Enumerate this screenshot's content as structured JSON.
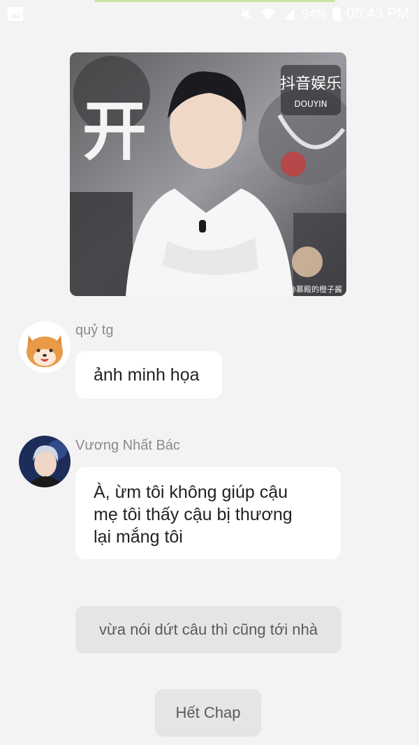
{
  "status_bar": {
    "battery_percent": "94%",
    "time": "05:43 PM",
    "icons": [
      "gallery-icon",
      "mute-icon",
      "wifi-icon",
      "signal-icon",
      "battery-icon"
    ]
  },
  "hero": {
    "description_icon": "photo",
    "overlay_chars": "开",
    "logo_text": "抖音娱乐",
    "logo_sub": "DOUYIN",
    "caption": "@慕殿的橙子酱"
  },
  "messages": [
    {
      "sender": "quỷ tg",
      "avatar_icon": "shiba-dog-avatar",
      "text": "ảnh minh họa"
    },
    {
      "sender": "Vương Nhất Bác",
      "avatar_icon": "person-avatar",
      "text": "À, ừm tôi không giúp cậu\nmẹ tôi thấy cậu bị thương\nlại mắng tôi"
    }
  ],
  "narration": "vừa nói dứt câu thì cũng tới nhà",
  "end_label": "Hết Chap"
}
